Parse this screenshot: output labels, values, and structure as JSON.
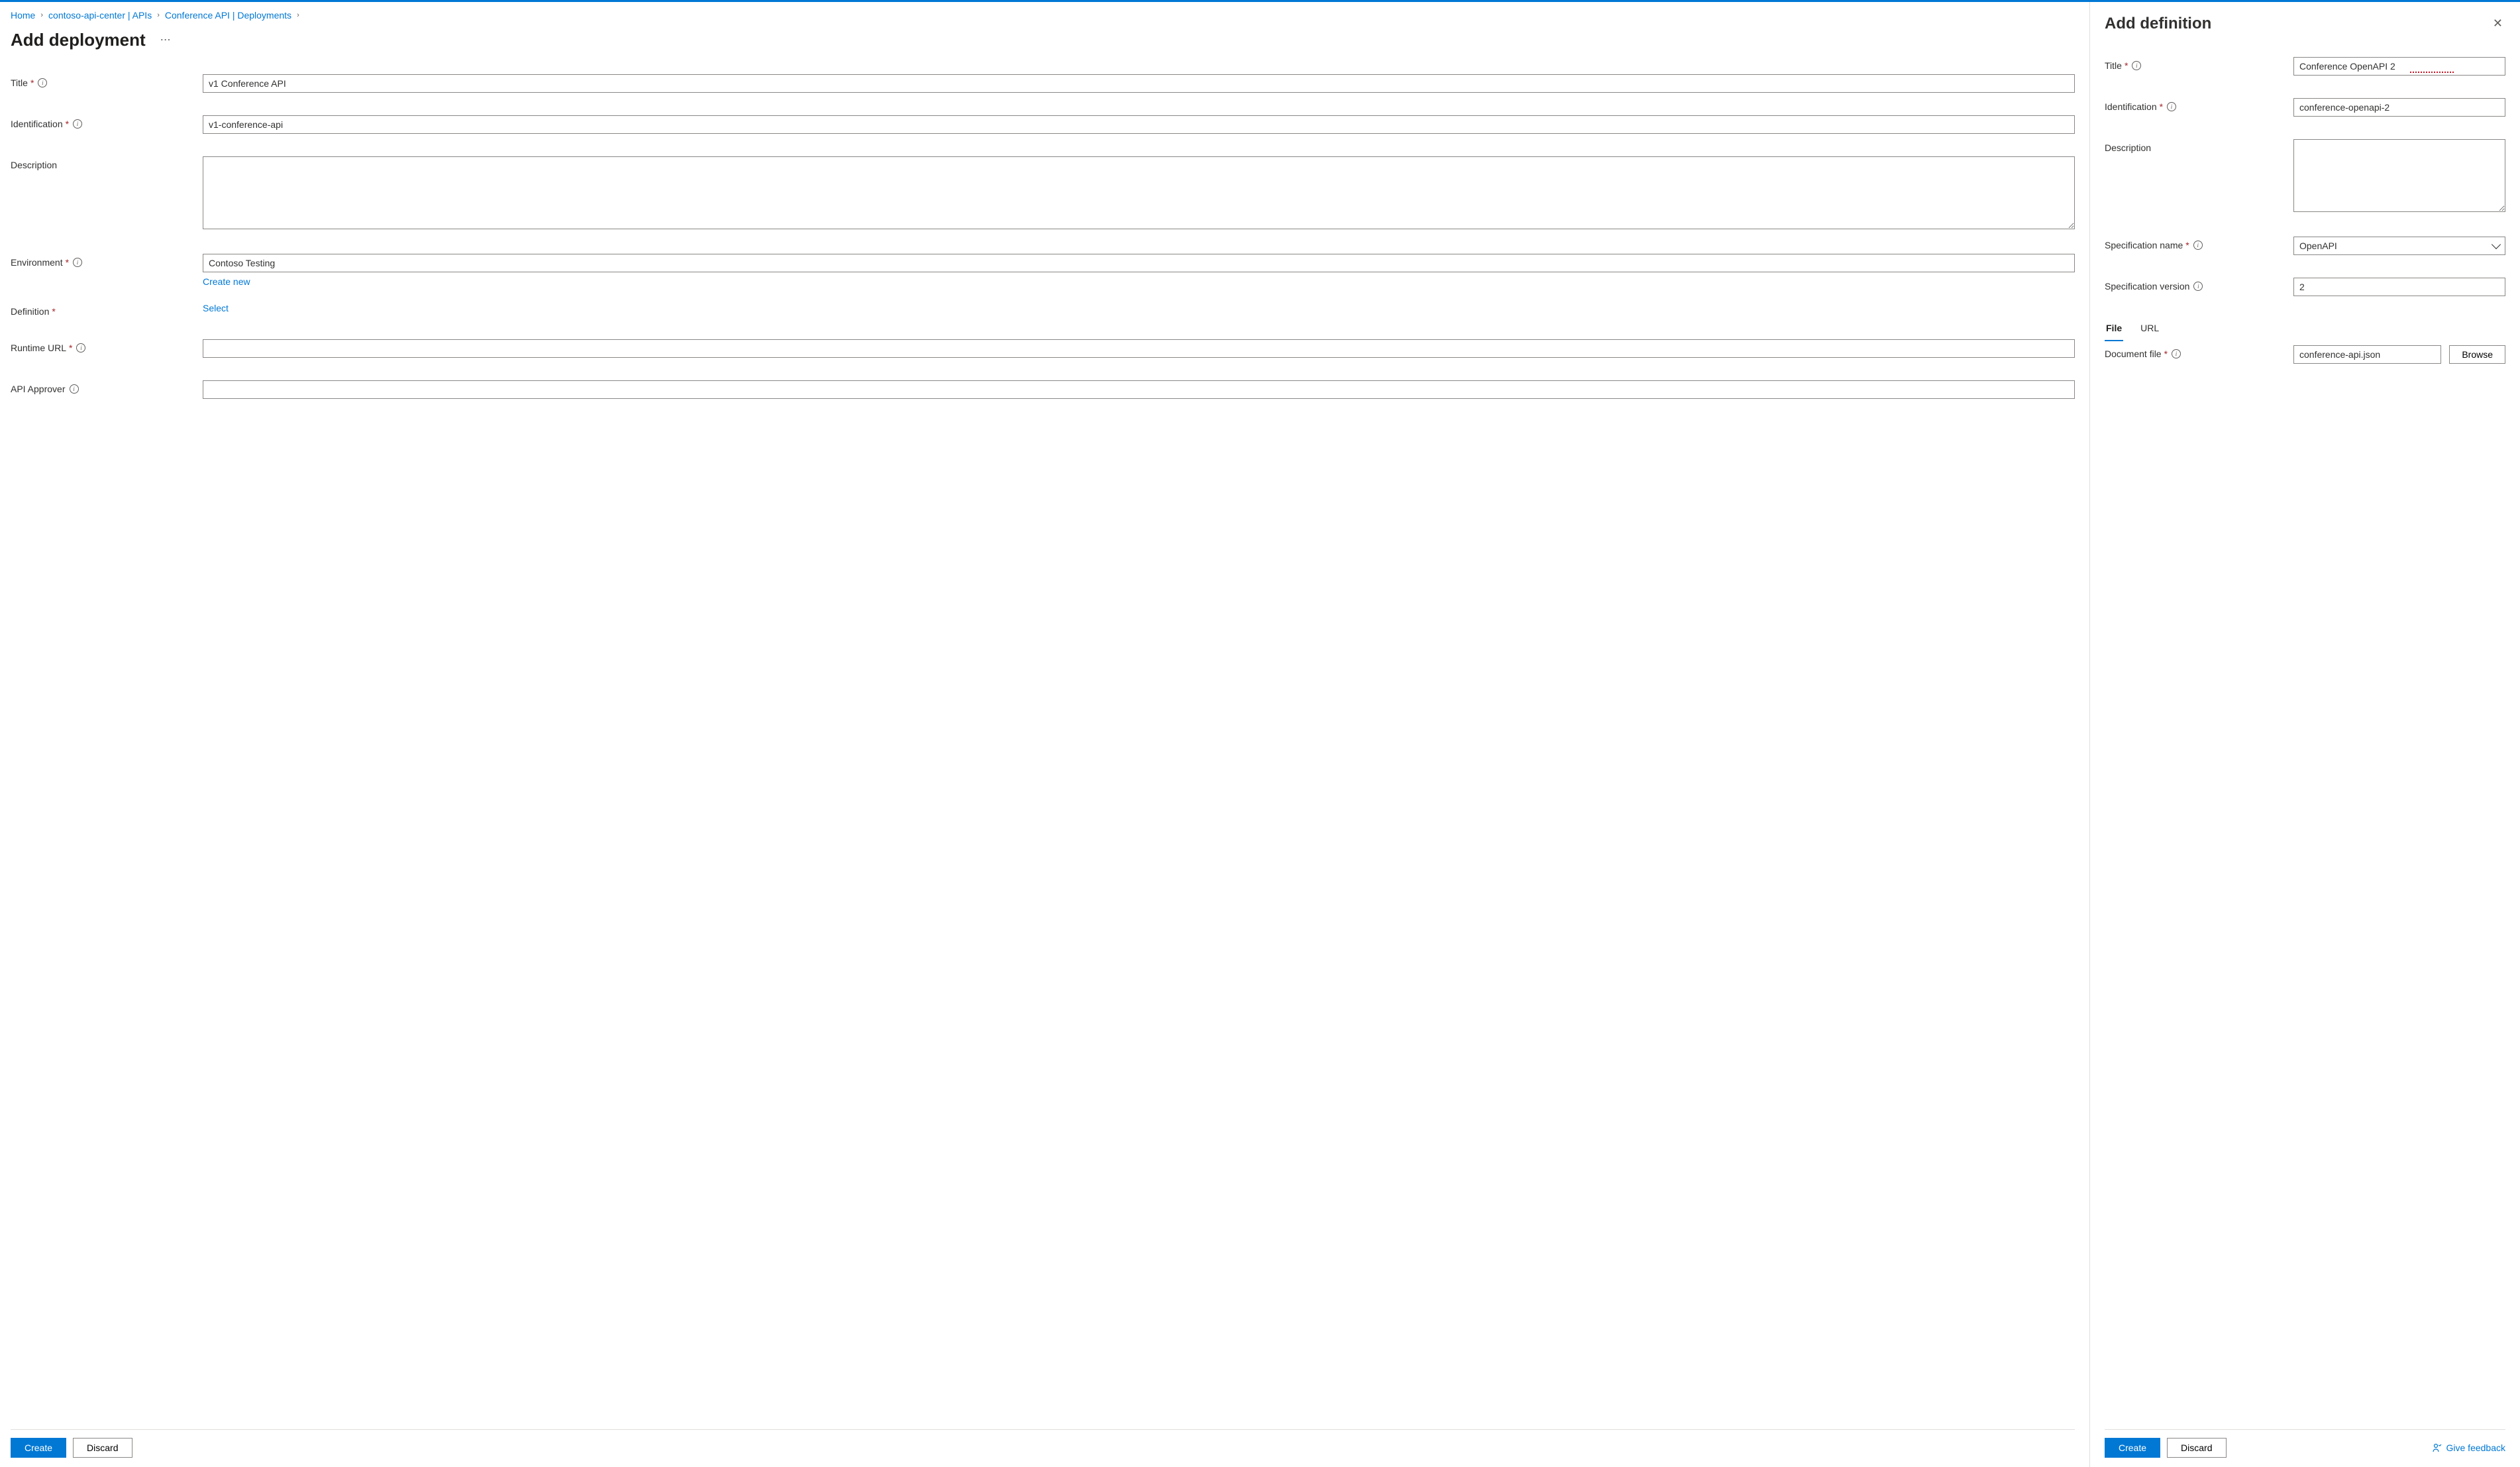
{
  "breadcrumb": {
    "items": [
      {
        "label": "Home"
      },
      {
        "label": "contoso-api-center | APIs"
      },
      {
        "label": "Conference API | Deployments"
      }
    ]
  },
  "main": {
    "title": "Add deployment",
    "fields": {
      "title": {
        "label": "Title",
        "value": "v1 Conference API",
        "required": true,
        "info": true
      },
      "identification": {
        "label": "Identification",
        "value": "v1-conference-api",
        "required": true,
        "info": true
      },
      "description": {
        "label": "Description",
        "value": ""
      },
      "environment": {
        "label": "Environment",
        "value": "Contoso Testing",
        "required": true,
        "info": true,
        "helper": "Create new"
      },
      "definition": {
        "label": "Definition",
        "required": true,
        "linkText": "Select"
      },
      "runtime_url": {
        "label": "Runtime URL",
        "value": "",
        "required": true,
        "info": true
      },
      "api_approver": {
        "label": "API Approver",
        "value": "",
        "info": true
      }
    },
    "buttons": {
      "create": "Create",
      "discard": "Discard"
    }
  },
  "panel": {
    "title": "Add definition",
    "fields": {
      "title": {
        "label": "Title",
        "value": "Conference OpenAPI 2",
        "required": true,
        "info": true
      },
      "identification": {
        "label": "Identification",
        "value": "conference-openapi-2",
        "required": true,
        "info": true
      },
      "description": {
        "label": "Description",
        "value": ""
      },
      "spec_name": {
        "label": "Specification name",
        "value": "OpenAPI",
        "required": true,
        "info": true
      },
      "spec_version": {
        "label": "Specification version",
        "value": "2",
        "info": true
      },
      "tabs": {
        "file": "File",
        "url": "URL"
      },
      "document_file": {
        "label": "Document file",
        "value": "conference-api.json",
        "required": true,
        "info": true,
        "browse": "Browse"
      }
    },
    "buttons": {
      "create": "Create",
      "discard": "Discard"
    },
    "feedback": "Give feedback"
  }
}
